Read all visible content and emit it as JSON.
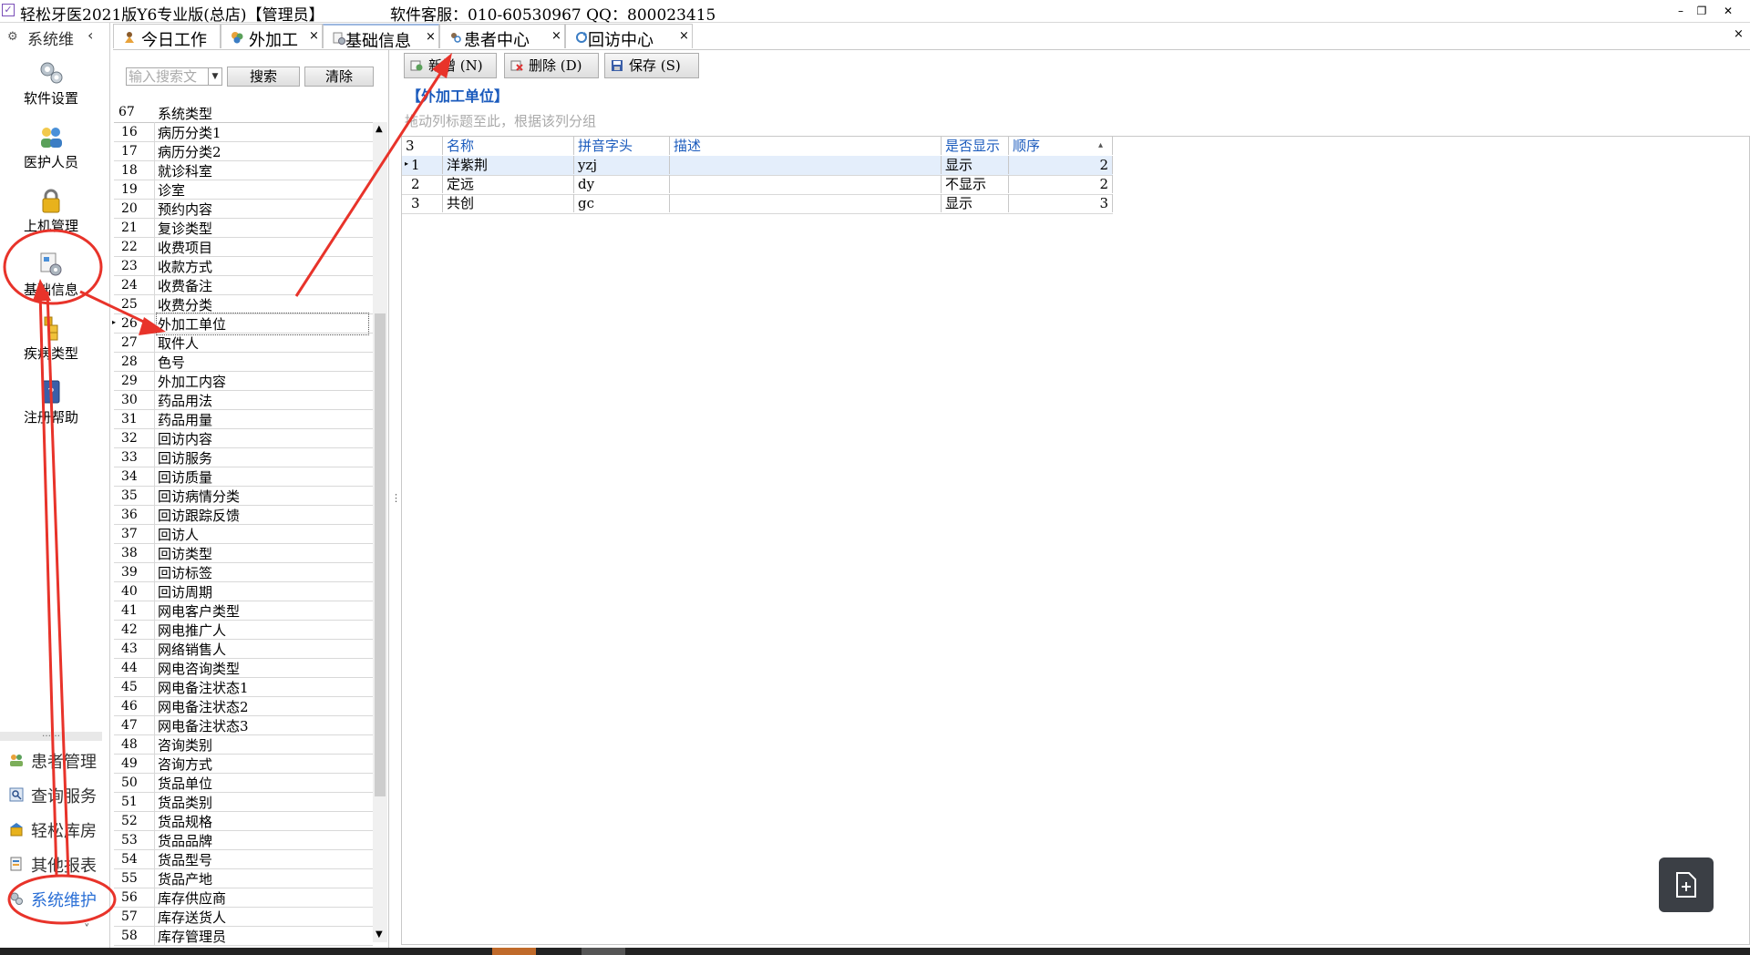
{
  "window": {
    "app_title": "轻松牙医2021版Y6专业版(总店)【管理员】",
    "support_text": "软件客服：010-60530967 QQ：800023415",
    "minimize": "–",
    "restore": "❐",
    "close": "✕"
  },
  "sidebar": {
    "header_label": "系统维",
    "header_chevron": "‹",
    "big_items": [
      {
        "label": "软件设置",
        "icon": "gear-cluster-icon"
      },
      {
        "label": "医护人员",
        "icon": "staff-people-icon"
      },
      {
        "label": "上机管理",
        "icon": "padlock-icon"
      },
      {
        "label": "基础信息",
        "icon": "settings-document-icon"
      },
      {
        "label": "疾病类型",
        "icon": "stacked-folders-icon"
      },
      {
        "label": "注册帮助",
        "icon": "help-book-icon"
      }
    ],
    "divider_dots": "……",
    "small_items": [
      {
        "label": "患者管理",
        "icon": "patients-icon"
      },
      {
        "label": "查询服务",
        "icon": "query-icon"
      },
      {
        "label": "轻松库房",
        "icon": "warehouse-icon"
      },
      {
        "label": "其他报表",
        "icon": "reports-icon"
      },
      {
        "label": "系统维护",
        "icon": "system-maintenance-icon",
        "active": true
      }
    ],
    "bottom_chevron": "˅"
  },
  "tabs": [
    {
      "label": "今日工作",
      "closable": false
    },
    {
      "label": "外加工",
      "closable": true
    },
    {
      "label": "基础信息",
      "closable": true,
      "active": true
    },
    {
      "label": "患者中心",
      "closable": true
    },
    {
      "label": "回访中心",
      "closable": true
    }
  ],
  "tab_close_glyph": "×",
  "categories": {
    "search_placeholder": "输入搜索文",
    "search_button": "搜索",
    "clear_button": "清除",
    "count": "67",
    "column_header": "系统类型",
    "selected_index": 26,
    "rows": [
      {
        "num": "16",
        "label": "病历分类1"
      },
      {
        "num": "17",
        "label": "病历分类2"
      },
      {
        "num": "18",
        "label": "就诊科室"
      },
      {
        "num": "19",
        "label": "诊室"
      },
      {
        "num": "20",
        "label": "预约内容"
      },
      {
        "num": "21",
        "label": "复诊类型"
      },
      {
        "num": "22",
        "label": "收费项目"
      },
      {
        "num": "23",
        "label": "收款方式"
      },
      {
        "num": "24",
        "label": "收费备注"
      },
      {
        "num": "25",
        "label": "收费分类"
      },
      {
        "num": "26",
        "label": "外加工单位"
      },
      {
        "num": "27",
        "label": "取件人"
      },
      {
        "num": "28",
        "label": "色号"
      },
      {
        "num": "29",
        "label": "外加工内容"
      },
      {
        "num": "30",
        "label": "药品用法"
      },
      {
        "num": "31",
        "label": "药品用量"
      },
      {
        "num": "32",
        "label": "回访内容"
      },
      {
        "num": "33",
        "label": "回访服务"
      },
      {
        "num": "34",
        "label": "回访质量"
      },
      {
        "num": "35",
        "label": "回访病情分类"
      },
      {
        "num": "36",
        "label": "回访跟踪反馈"
      },
      {
        "num": "37",
        "label": "回访人"
      },
      {
        "num": "38",
        "label": "回访类型"
      },
      {
        "num": "39",
        "label": "回访标签"
      },
      {
        "num": "40",
        "label": "回访周期"
      },
      {
        "num": "41",
        "label": "网电客户类型"
      },
      {
        "num": "42",
        "label": "网电推广人"
      },
      {
        "num": "43",
        "label": "网络销售人"
      },
      {
        "num": "44",
        "label": "网电咨询类型"
      },
      {
        "num": "45",
        "label": "网电备注状态1"
      },
      {
        "num": "46",
        "label": "网电备注状态2"
      },
      {
        "num": "47",
        "label": "网电备注状态3"
      },
      {
        "num": "48",
        "label": "咨询类别"
      },
      {
        "num": "49",
        "label": "咨询方式"
      },
      {
        "num": "50",
        "label": "货品单位"
      },
      {
        "num": "51",
        "label": "货品类别"
      },
      {
        "num": "52",
        "label": "货品规格"
      },
      {
        "num": "53",
        "label": "货品品牌"
      },
      {
        "num": "54",
        "label": "货品型号"
      },
      {
        "num": "55",
        "label": "货品产地"
      },
      {
        "num": "56",
        "label": "库存供应商"
      },
      {
        "num": "57",
        "label": "库存送货人"
      },
      {
        "num": "58",
        "label": "库存管理员"
      }
    ]
  },
  "toolbar": {
    "add_label": "新增 (N)",
    "delete_label": "删除 (D)",
    "save_label": "保存 (S)"
  },
  "main": {
    "section_title": "【外加工单位】",
    "group_hint": "拖动列标题至此，根据该列分组",
    "row_count": "3",
    "columns": [
      "名称",
      "拼音字头",
      "描述",
      "是否显示",
      "顺序"
    ],
    "sort_glyph": "▴",
    "rows": [
      {
        "idx": "1",
        "name": "洋紫荆",
        "pinyin": "yzj",
        "desc": "",
        "show": "显示",
        "order": "2"
      },
      {
        "idx": "2",
        "name": "定远",
        "pinyin": "dy",
        "desc": "",
        "show": "不显示",
        "order": "2"
      },
      {
        "idx": "3",
        "name": "共创",
        "pinyin": "gc",
        "desc": "",
        "show": "显示",
        "order": "3"
      }
    ]
  },
  "colors": {
    "annotation_red": "#e8332a",
    "header_blue": "#1b5bbd",
    "active_nav_blue": "#2a6fd6"
  }
}
